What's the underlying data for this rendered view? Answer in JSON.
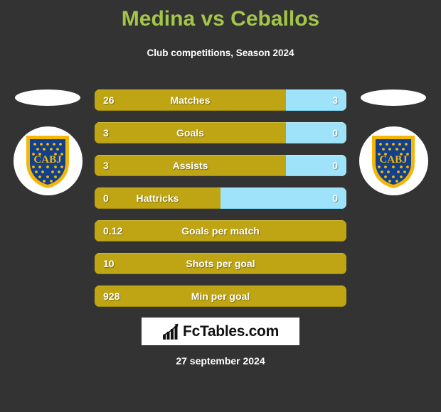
{
  "header": {
    "title": "Medina vs Ceballos",
    "subtitle": "Club competitions, Season 2024",
    "title_color": "#a3c64a"
  },
  "teams": {
    "home": {
      "crest_name": "CABJ",
      "crest_label": "cabj-crest"
    },
    "away": {
      "crest_name": "CABJ",
      "crest_label": "cabj-crest"
    }
  },
  "colors": {
    "background": "#333333",
    "home_bar": "#bfa513",
    "away_bar": "#9fe3fb",
    "crest_blue": "#12408a",
    "crest_gold": "#f5b60a",
    "text": "#ffffff"
  },
  "chart_data": {
    "type": "bar",
    "title": "Medina vs Ceballos",
    "subtitle": "Club competitions, Season 2024",
    "orientation": "horizontal-diverging",
    "series": [
      {
        "name": "Medina",
        "color": "#bfa513"
      },
      {
        "name": "Ceballos",
        "color": "#9fe3fb"
      }
    ],
    "categories": [
      "Matches",
      "Goals",
      "Assists",
      "Hattricks",
      "Goals per match",
      "Shots per goal",
      "Min per goal"
    ],
    "rows": [
      {
        "label": "Matches",
        "home": "26",
        "away": "3",
        "home_pct": 76,
        "has_away": true
      },
      {
        "label": "Goals",
        "home": "3",
        "away": "0",
        "home_pct": 76,
        "has_away": true
      },
      {
        "label": "Assists",
        "home": "3",
        "away": "0",
        "home_pct": 76,
        "has_away": true
      },
      {
        "label": "Hattricks",
        "home": "0",
        "away": "0",
        "home_pct": 50,
        "has_away": true
      },
      {
        "label": "Goals per match",
        "home": "0.12",
        "away": "",
        "home_pct": 100,
        "has_away": false
      },
      {
        "label": "Shots per goal",
        "home": "10",
        "away": "",
        "home_pct": 100,
        "has_away": false
      },
      {
        "label": "Min per goal",
        "home": "928",
        "away": "",
        "home_pct": 100,
        "has_away": false
      }
    ]
  },
  "footer": {
    "logo_text": "FcTables.com",
    "logo_icon": "bar-chart-growth-icon",
    "date": "27 september 2024"
  }
}
